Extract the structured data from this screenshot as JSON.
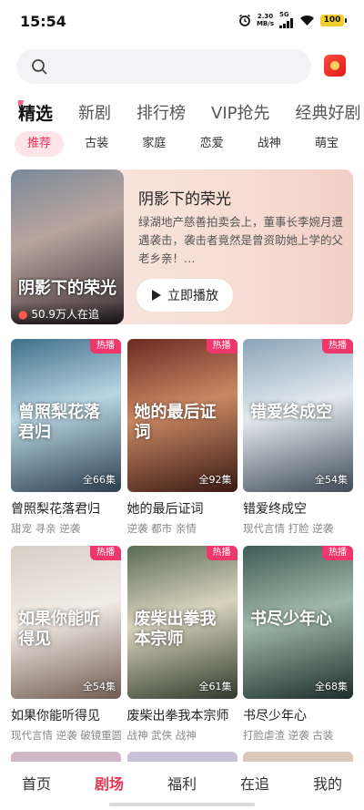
{
  "status": {
    "time": "15:54",
    "speed_value": "2.30",
    "speed_unit": "MB/s",
    "network": "5G",
    "battery": "100"
  },
  "search": {
    "icon": "search-icon"
  },
  "main_tabs": [
    "精选",
    "新剧",
    "排行榜",
    "VIP抢先",
    "经典好剧"
  ],
  "categories": [
    "推荐",
    "古装",
    "家庭",
    "恋爱",
    "战神",
    "萌宝"
  ],
  "featured": {
    "title": "阴影下的荣光",
    "poster_title": "阴影下的荣光",
    "views": "50.9万人在追",
    "description": "绿湖地产慈善拍卖会上，董事长李婉月遭遇袭击，袭击者竟然是曾资助她上学的父老乡亲！…",
    "play_label": "立即播放"
  },
  "dramas": [
    {
      "title": "曾照梨花落君归",
      "poster_title": "曾照梨花落君归",
      "tags": "甜宠 寻亲 逆袭",
      "episodes": "全66集",
      "badge": "热播",
      "colors": [
        "#3f6f8a",
        "#b9d6e2",
        "#2c3e50"
      ]
    },
    {
      "title": "她的最后证词",
      "poster_title": "她的最后证词",
      "tags": "逆袭 都市 亲情",
      "episodes": "全92集",
      "badge": "热播",
      "colors": [
        "#6b2a22",
        "#c98863",
        "#3a1a14"
      ]
    },
    {
      "title": "错爱终成空",
      "poster_title": "错爱终成空",
      "tags": "现代言情 打脸 逆袭",
      "episodes": "全54集",
      "badge": "热播",
      "colors": [
        "#8aa4b8",
        "#e3e9ef",
        "#3f4b57"
      ]
    },
    {
      "title": "如果你能听得见",
      "poster_title": "如果你能听得见",
      "tags": "现代言情 逆袭 破镜重圆",
      "episodes": "全54集",
      "badge": "热播",
      "colors": [
        "#d7cfc6",
        "#f3ece6",
        "#6e5c52"
      ]
    },
    {
      "title": "废柴出拳我本宗师",
      "poster_title": "废柴出拳我本宗师",
      "tags": "战神 武侠 战神",
      "episodes": "全61集",
      "badge": "热播",
      "colors": [
        "#5a6b54",
        "#d9d3bf",
        "#2f3a2b"
      ]
    },
    {
      "title": "书尽少年心",
      "poster_title": "书尽少年心",
      "tags": "打脸虐渣 逆袭 古装",
      "episodes": "全68集",
      "badge": "热播",
      "colors": [
        "#3f5a55",
        "#9fb8a9",
        "#1e2d2b"
      ]
    }
  ],
  "bottom_nav": [
    "首页",
    "剧场",
    "福利",
    "在追",
    "我的"
  ],
  "accent": "#e8364f"
}
